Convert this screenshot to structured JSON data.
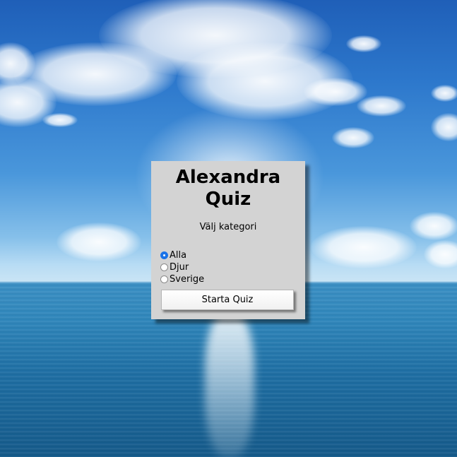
{
  "quiz": {
    "title": "Alexandra Quiz",
    "subtitle": "Välj kategori",
    "categories": [
      {
        "label": "Alla",
        "selected": true
      },
      {
        "label": "Djur",
        "selected": false
      },
      {
        "label": "Sverige",
        "selected": false
      }
    ],
    "start_button_label": "Starta Quiz"
  },
  "colors": {
    "panel_background": "#d3d3d3",
    "radio_selected": "#1a73e8"
  }
}
